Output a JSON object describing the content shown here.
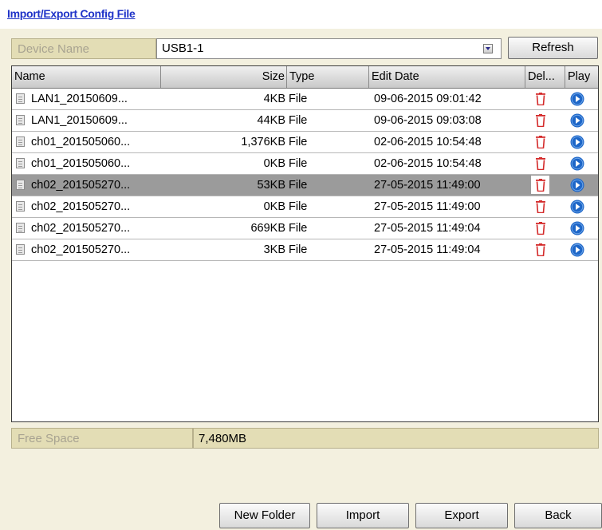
{
  "header": {
    "title": "Import/Export Config File"
  },
  "device": {
    "label": "Device Name",
    "selected": "USB1-1",
    "refresh_label": "Refresh"
  },
  "table": {
    "columns": {
      "name": "Name",
      "size": "Size",
      "type": "Type",
      "edit_date": "Edit Date",
      "delete": "Del...",
      "play": "Play"
    },
    "rows": [
      {
        "name": "LAN1_20150609...",
        "size": "4KB",
        "type": "File",
        "edit_date": "09-06-2015 09:01:42",
        "selected": false
      },
      {
        "name": "LAN1_20150609...",
        "size": "44KB",
        "type": "File",
        "edit_date": "09-06-2015 09:03:08",
        "selected": false
      },
      {
        "name": "ch01_201505060...",
        "size": "1,376KB",
        "type": "File",
        "edit_date": "02-06-2015 10:54:48",
        "selected": false
      },
      {
        "name": "ch01_201505060...",
        "size": "0KB",
        "type": "File",
        "edit_date": "02-06-2015 10:54:48",
        "selected": false
      },
      {
        "name": "ch02_201505270...",
        "size": "53KB",
        "type": "File",
        "edit_date": "27-05-2015 11:49:00",
        "selected": true
      },
      {
        "name": "ch02_201505270...",
        "size": "0KB",
        "type": "File",
        "edit_date": "27-05-2015 11:49:00",
        "selected": false
      },
      {
        "name": "ch02_201505270...",
        "size": "669KB",
        "type": "File",
        "edit_date": "27-05-2015 11:49:04",
        "selected": false
      },
      {
        "name": "ch02_201505270...",
        "size": "3KB",
        "type": "File",
        "edit_date": "27-05-2015 11:49:04",
        "selected": false
      }
    ]
  },
  "free_space": {
    "label": "Free Space",
    "value": "7,480MB"
  },
  "buttons": {
    "new_folder": "New Folder",
    "import": "Import",
    "export": "Export",
    "back": "Back"
  },
  "icons": {
    "row_file": "file-icon",
    "delete": "trash-icon",
    "play": "play-icon",
    "dropdown": "chevron-down-icon"
  },
  "colors": {
    "panel_bg": "#f3f0df",
    "label_bg": "#e3ddb5",
    "title_link": "#1f33c8",
    "selected_row": "#9b9b9b",
    "delete_icon": "#d42a2a",
    "play_icon": "#1d66c8"
  }
}
